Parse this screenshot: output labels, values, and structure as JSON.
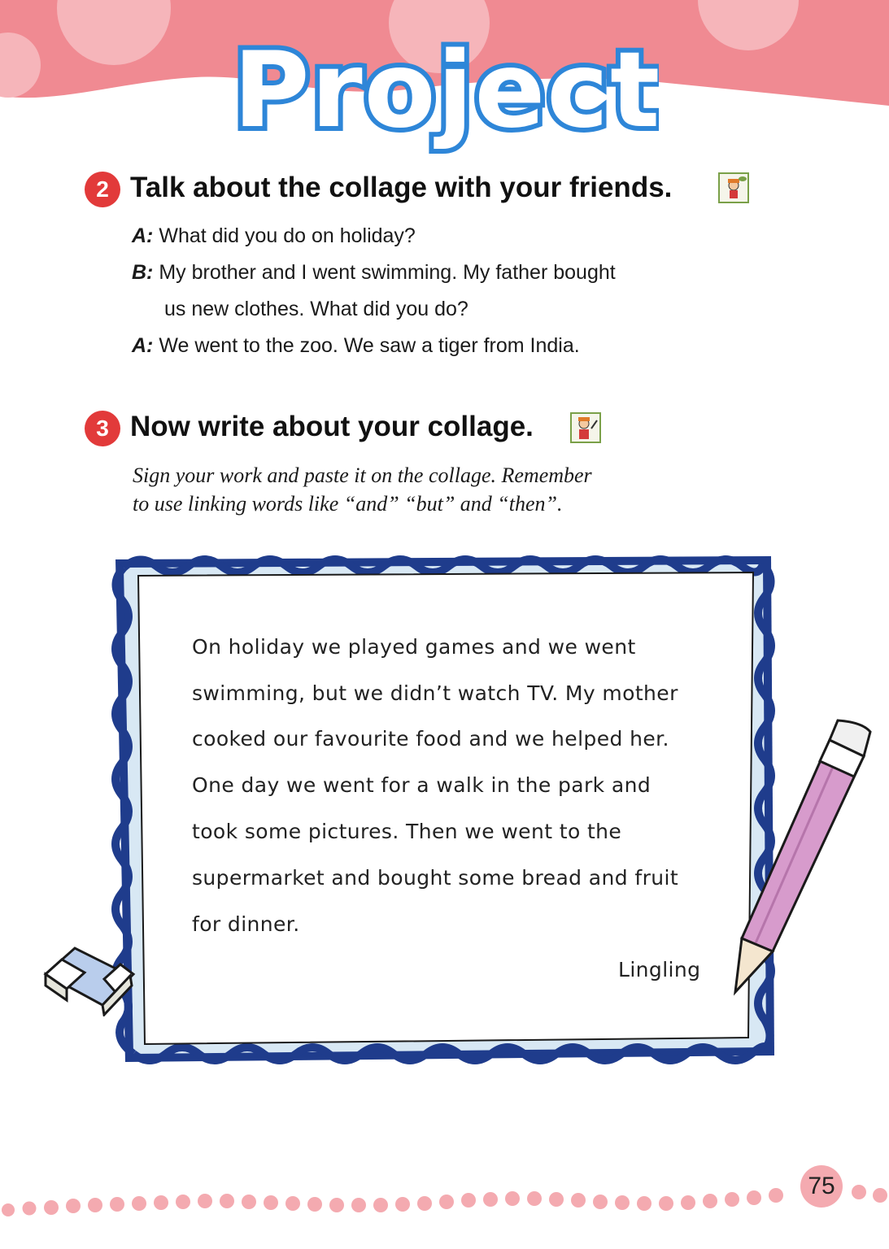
{
  "header": {
    "title": "Project"
  },
  "section2": {
    "number": "2",
    "heading": "Talk about the collage with your friends.",
    "icon": "talking-boy-icon",
    "dialogue": [
      {
        "speaker": "A:",
        "text": "What did you do on holiday?"
      },
      {
        "speaker": "B:",
        "text": "My brother and I went swimming. My father bought"
      },
      {
        "speaker": "",
        "text": "us new clothes. What did you do?"
      },
      {
        "speaker": "A:",
        "text": "We went to the zoo. We saw a tiger from India."
      }
    ]
  },
  "section3": {
    "number": "3",
    "heading": "Now write about your collage.",
    "icon": "writing-boy-icon",
    "instructions": [
      "Sign your work and paste it on the collage. Remember",
      "to use linking words like “and” “but” and “then”."
    ]
  },
  "card": {
    "lines": [
      "On holiday we played games and we went",
      "swimming, but we didn’t watch TV. My mother",
      "cooked our favourite food and we helped her.",
      "One day we went for a walk in the park and",
      "took some pictures. Then we went to the",
      "supermarket and bought some bread and fruit",
      "for dinner."
    ],
    "signature": "Lingling"
  },
  "footer": {
    "page_number": "75"
  },
  "colors": {
    "banner": "#f08a92",
    "banner_dots": "#f6b5ba",
    "badge": "#e23a3a",
    "frame_dark": "#1f3c8c",
    "frame_light": "#d8e8f4",
    "title_blue": "#2e86d8"
  }
}
